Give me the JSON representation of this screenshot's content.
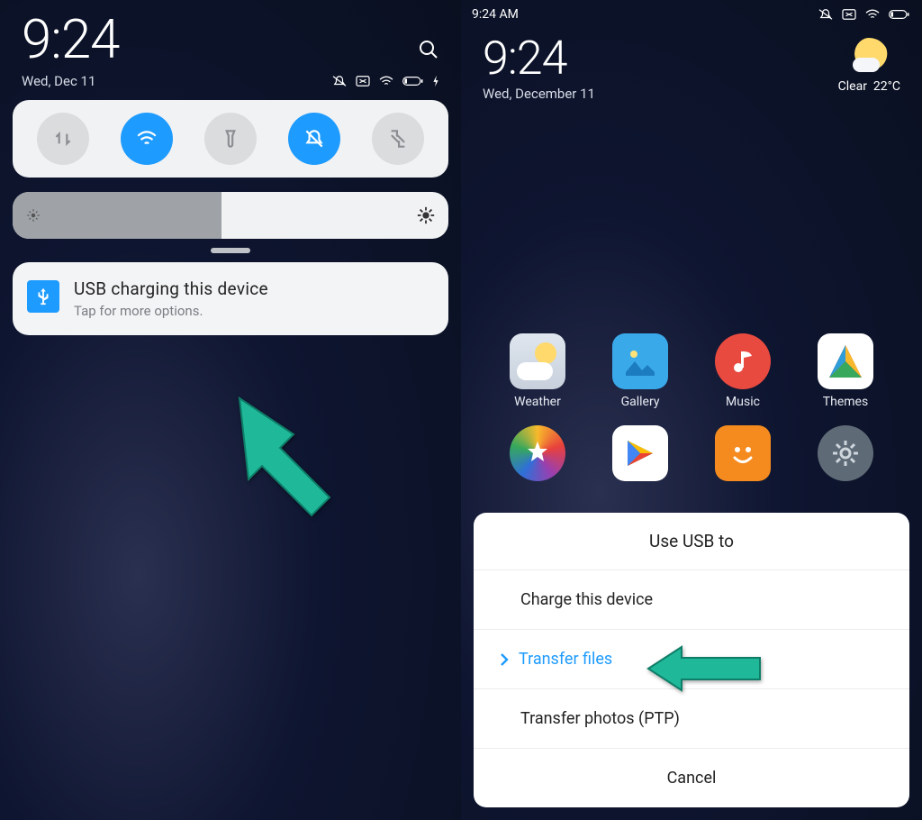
{
  "left": {
    "status_time": "",
    "clock": "9:24",
    "date": "Wed,  Dec 11",
    "toggles": [
      "data",
      "wifi",
      "flashlight",
      "dnd",
      "screenshot"
    ],
    "notification": {
      "title": "USB  charging  this  device",
      "subtitle": "Tap for more options."
    }
  },
  "right": {
    "status_time": "9:24 AM",
    "clock": "9:24",
    "date": "Wed, December 11",
    "weather": {
      "condition": "Clear",
      "temp": "22°C"
    },
    "apps_row1": [
      "Weather",
      "Gallery",
      "Music",
      "Themes"
    ],
    "apps_row2_visible": 4,
    "dialog": {
      "title": "Use USB to",
      "items": [
        {
          "label": "Charge this device",
          "selected": false
        },
        {
          "label": "Transfer files",
          "selected": true
        },
        {
          "label": "Transfer photos (PTP)",
          "selected": false
        }
      ],
      "cancel": "Cancel"
    }
  },
  "colors": {
    "accent": "#1e9bff",
    "arrow": "#1fb99a"
  }
}
